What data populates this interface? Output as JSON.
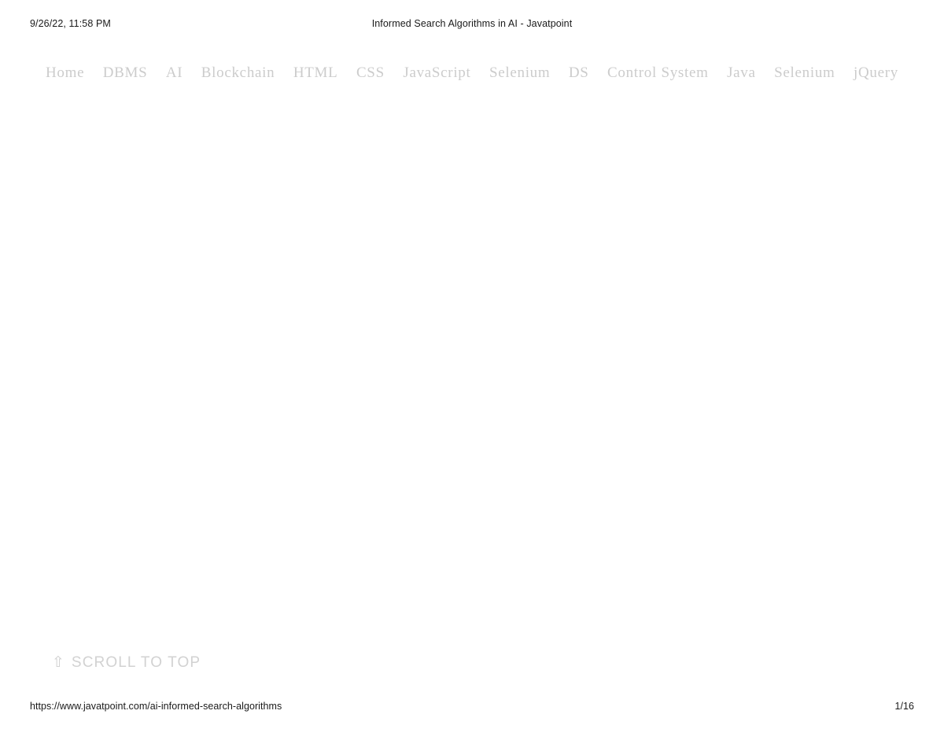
{
  "print_header": {
    "date": "9/26/22, 11:58 PM",
    "document_title": "Informed Search Algorithms in AI - Javatpoint"
  },
  "nav": {
    "items": [
      {
        "label": "Home"
      },
      {
        "label": "DBMS"
      },
      {
        "label": "AI"
      },
      {
        "label": "Blockchain"
      },
      {
        "label": "HTML"
      },
      {
        "label": "CSS"
      },
      {
        "label": "JavaScript"
      },
      {
        "label": "Selenium"
      },
      {
        "label": "DS"
      },
      {
        "label": "Control System"
      },
      {
        "label": "Java"
      },
      {
        "label": "Selenium"
      },
      {
        "label": "jQuery"
      }
    ]
  },
  "main": {
    "content": ""
  },
  "scroll_to_top": {
    "icon": "scroll-up-arrow-icon",
    "icon_glyph": "⇧",
    "label": "SCROLL TO TOP"
  },
  "print_footer": {
    "url": "https://www.javatpoint.com/ai-informed-search-algorithms",
    "page_indicator": "1/16"
  },
  "colors": {
    "background": "#ffffff",
    "print_text": "#1a1a1a",
    "nav_text": "#cccccc",
    "scroll_top_text": "#d2d2d2"
  }
}
